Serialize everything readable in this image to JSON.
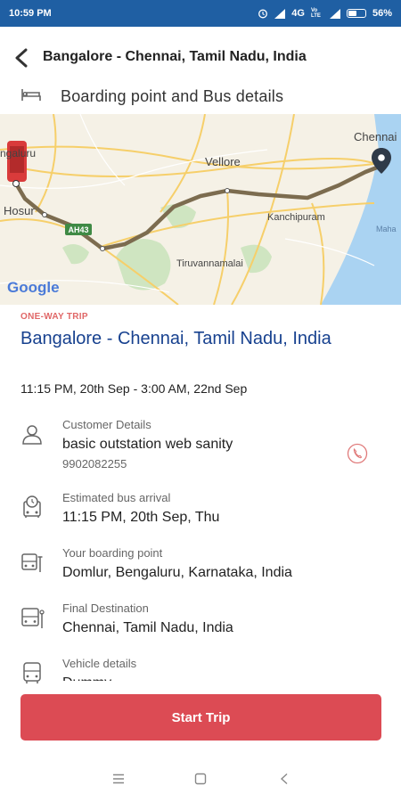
{
  "status_bar": {
    "time": "10:59 PM",
    "network": "4G",
    "volte": "Vo LTE",
    "battery": "56%",
    "battery_level": 0.56
  },
  "header": {
    "title": "Bangalore - Chennai, Tamil Nadu, India"
  },
  "boarding": {
    "label": "Boarding point and Bus details"
  },
  "map": {
    "places": {
      "bengaluru": "ngaluru",
      "chennai": "Chennai",
      "vellore": "Vellore",
      "hosur": "Hosur",
      "kanchipuram": "Kanchipuram",
      "tiruvannamalai": "Tiruvannamalai",
      "mahabalipuram": "Maha"
    },
    "highway": "AH43",
    "logo": "Google"
  },
  "trip": {
    "type": "ONE-WAY TRIP",
    "title": "Bangalore - Chennai, Tamil Nadu, India",
    "time": "11:15 PM, 20th Sep - 3:00 AM, 22nd Sep"
  },
  "details": {
    "customer": {
      "label": "Customer Details",
      "name": "basic outstation web sanity",
      "phone": "9902082255"
    },
    "arrival": {
      "label": "Estimated bus arrival",
      "value": "11:15 PM, 20th Sep, Thu"
    },
    "boarding": {
      "label": "Your boarding point",
      "value": "Domlur, Bengaluru, Karnataka, India"
    },
    "destination": {
      "label": "Final Destination",
      "value": "Chennai, Tamil Nadu, India"
    },
    "vehicle": {
      "label": "Vehicle details",
      "value": "Dummy"
    }
  },
  "actions": {
    "start_trip": "Start Trip"
  },
  "colors": {
    "status_bar": "#1f5fa3",
    "title_blue": "#17418f",
    "trip_type_red": "#e06767",
    "button_red": "#dc4b54"
  }
}
